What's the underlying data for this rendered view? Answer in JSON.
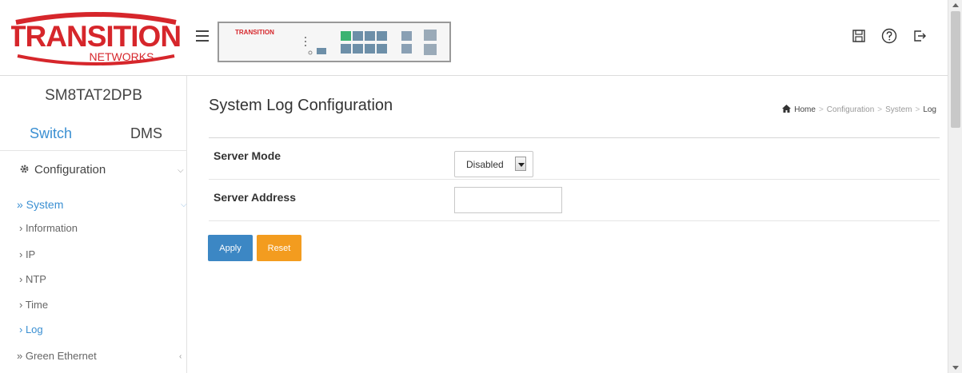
{
  "brand": {
    "logo_line1": "TRANSITION",
    "logo_line2": "NETWORKS",
    "logo_color": "#d6262b",
    "mini_logo": "TRANSITION"
  },
  "topbar": {
    "icons": [
      "save-icon",
      "help-icon",
      "logout-icon"
    ]
  },
  "sidebar": {
    "device_name": "SM8TAT2DPB",
    "tabs": [
      {
        "label": "Switch",
        "active": true
      },
      {
        "label": "DMS",
        "active": false
      }
    ],
    "sections": {
      "configuration": "Configuration",
      "system": "» System",
      "green_ethernet": "» Green Ethernet"
    },
    "system_items": [
      {
        "label": "› Information",
        "active": false
      },
      {
        "label": "› IP",
        "active": false
      },
      {
        "label": "› NTP",
        "active": false
      },
      {
        "label": "› Time",
        "active": false
      },
      {
        "label": "› Log",
        "active": true
      }
    ]
  },
  "main": {
    "title": "System Log Configuration",
    "breadcrumb": [
      "Home",
      "Configuration",
      "System",
      "Log"
    ],
    "form": {
      "server_mode_label": "Server Mode",
      "server_mode_value": "Disabled",
      "server_address_label": "Server Address",
      "server_address_value": ""
    },
    "buttons": {
      "apply": "Apply",
      "reset": "Reset"
    }
  },
  "colors": {
    "accent_blue": "#3a8fd2",
    "apply_blue": "#3c87c4",
    "reset_orange": "#f39c1f"
  }
}
